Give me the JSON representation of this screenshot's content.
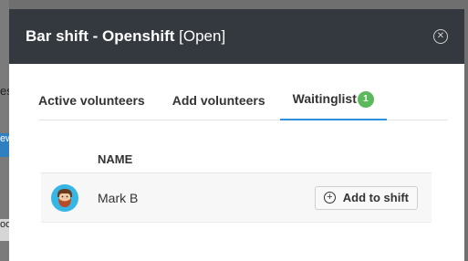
{
  "background": {
    "text_fragment": "es",
    "button_fragment": "ew",
    "gray_fragment": "oo"
  },
  "modal": {
    "title": "Bar shift - Openshift",
    "status": "[Open]",
    "close_icon": "close-circle-icon"
  },
  "tabs": [
    {
      "label": "Active volunteers",
      "active": false
    },
    {
      "label": "Add volunteers",
      "active": false
    },
    {
      "label": "Waitinglist",
      "active": true,
      "badge": "1"
    }
  ],
  "table": {
    "headers": [
      "NAME"
    ],
    "rows": [
      {
        "name": "Mark B",
        "avatar_icon": "avatar-icon",
        "action_label": "Add to shift",
        "action_icon": "plus-circle-icon"
      }
    ]
  },
  "colors": {
    "header_bg": "#34393f",
    "tab_underline": "#2d8fe0",
    "badge": "#5cb85c",
    "avatar_bg": "#35b6e4"
  }
}
